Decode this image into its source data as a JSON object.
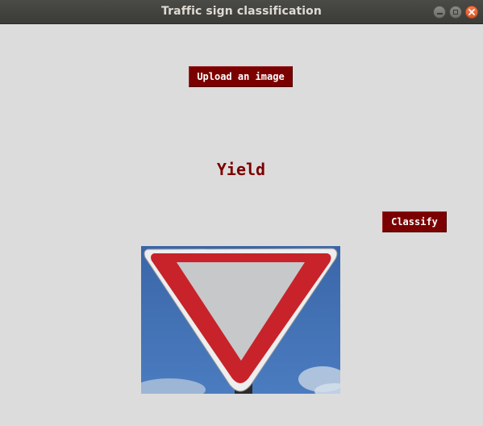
{
  "window": {
    "title": "Traffic sign classification",
    "controls": {
      "minimize_icon": "minimize-icon",
      "maximize_icon": "maximize-icon",
      "close_icon": "close-icon",
      "close_color": "#e9602f"
    }
  },
  "upload_button": {
    "label": "Upload an image"
  },
  "result": {
    "text": "Yield",
    "color": "#7b0000"
  },
  "classify_button": {
    "label": "Classify"
  },
  "preview_image": {
    "subject": "yield-sign",
    "colors": {
      "sky": "#3f6fb0",
      "border": "#c8232a",
      "inner": "#c7c8ca",
      "rim": "#f2f2f2"
    }
  },
  "colors": {
    "background": "#dcdcdc",
    "button_bg": "#7b0000",
    "button_text": "#ffffff",
    "titlebar": "#3c3b37"
  }
}
